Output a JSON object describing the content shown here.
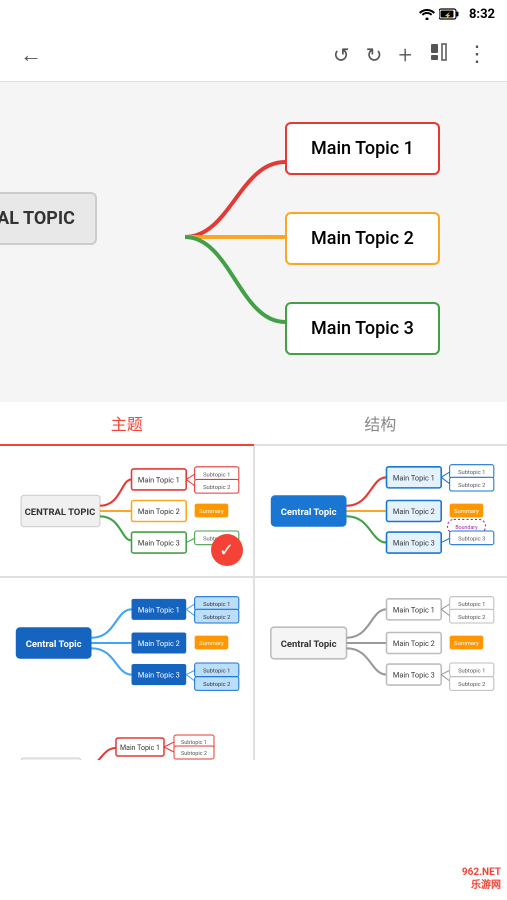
{
  "statusBar": {
    "time": "8:32"
  },
  "toolbar": {
    "backIcon": "←",
    "undoIcon": "↺",
    "redoIcon": "↻",
    "addIcon": "+",
    "formatIcon": "⬛",
    "moreIcon": "⋮"
  },
  "mindmap": {
    "centralTopic": "NTRAL TOPIC",
    "topics": [
      {
        "label": "Main Topic 1",
        "color": "#e53935"
      },
      {
        "label": "Main Topic 2",
        "color": "#f9a825"
      },
      {
        "label": "Main Topic 3",
        "color": "#43a047"
      }
    ]
  },
  "tabs": [
    {
      "label": "主题",
      "active": true
    },
    {
      "label": "结构",
      "active": false
    }
  ],
  "themes": {
    "selected": 0,
    "items": [
      {
        "id": 0,
        "type": "default-red"
      },
      {
        "id": 1,
        "type": "blue-central"
      },
      {
        "id": 2,
        "type": "blue-dark-central"
      },
      {
        "id": 3,
        "type": "light-central"
      }
    ]
  },
  "watermark": "962.NET\n乐游网"
}
